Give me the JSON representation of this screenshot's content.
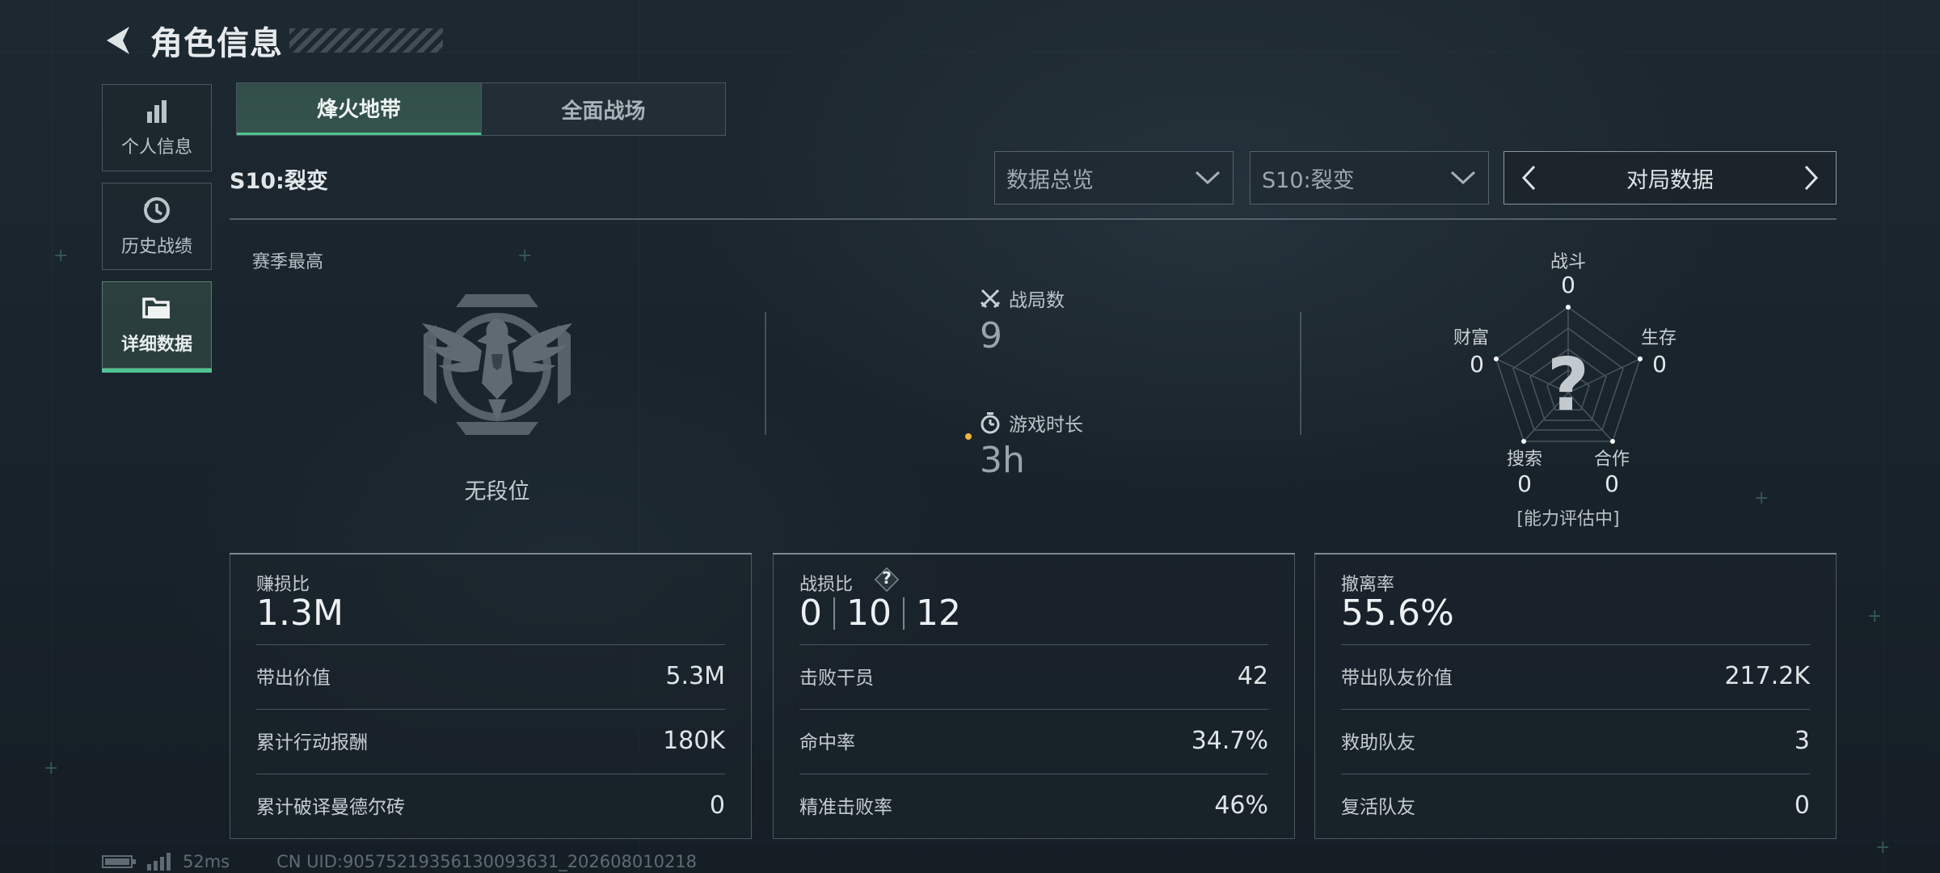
{
  "header": {
    "title": "角色信息"
  },
  "sidebar": {
    "items": [
      {
        "label": "个人信息",
        "icon": "bar-chart-icon"
      },
      {
        "label": "历史战绩",
        "icon": "history-clock-icon"
      },
      {
        "label": "详细数据",
        "icon": "folder-icon",
        "active": true
      }
    ]
  },
  "tabs": [
    {
      "label": "烽火地带",
      "active": true
    },
    {
      "label": "全面战场",
      "active": false
    }
  ],
  "season": {
    "label": "S10:裂变"
  },
  "filters": {
    "overview": "数据总览",
    "season": "S10:裂变",
    "match_data": "对局数据"
  },
  "overview": {
    "season_best_label": "赛季最高",
    "rank_text": "无段位",
    "matches_label": "战局数",
    "matches_value": "9",
    "playtime_label": "游戏时长",
    "playtime_value": "3h"
  },
  "radar": {
    "combat_label": "战斗",
    "combat_value": "0",
    "survival_label": "生存",
    "survival_value": "0",
    "coop_label": "合作",
    "coop_value": "0",
    "search_label": "搜索",
    "search_value": "0",
    "wealth_label": "财富",
    "wealth_value": "0",
    "center_symbol": "?",
    "note": "[能力评估中]",
    "accent": "#4fc393"
  },
  "cards": {
    "profit": {
      "label": "赚损比",
      "value": "1.3M",
      "rows": [
        {
          "k": "带出价值",
          "v": "5.3M"
        },
        {
          "k": "累计行动报酬",
          "v": "180K"
        },
        {
          "k": "累计破译曼德尔砖",
          "v": "0"
        }
      ]
    },
    "combat": {
      "label": "战损比",
      "help": "?",
      "kd": [
        "0",
        "10",
        "12"
      ],
      "rows": [
        {
          "k": "击败干员",
          "v": "42"
        },
        {
          "k": "命中率",
          "v": "34.7%"
        },
        {
          "k": "精准击败率",
          "v": "46%"
        }
      ]
    },
    "extract": {
      "label": "撤离率",
      "value": "55.6%",
      "rows": [
        {
          "k": "带出队友价值",
          "v": "217.2K"
        },
        {
          "k": "救助队友",
          "v": "3"
        },
        {
          "k": "复活队友",
          "v": "0"
        }
      ]
    }
  },
  "footer": {
    "ping": "52ms",
    "uid": "CN UID:9057521935613009363​1_202608010218"
  }
}
